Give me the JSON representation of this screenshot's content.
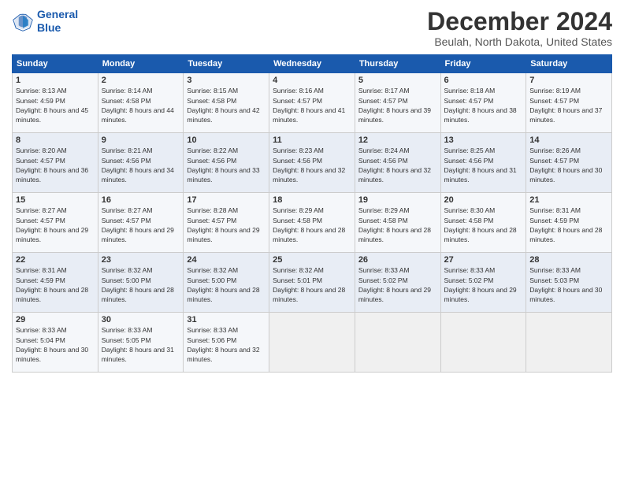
{
  "header": {
    "logo_line1": "General",
    "logo_line2": "Blue",
    "title": "December 2024",
    "location": "Beulah, North Dakota, United States"
  },
  "weekdays": [
    "Sunday",
    "Monday",
    "Tuesday",
    "Wednesday",
    "Thursday",
    "Friday",
    "Saturday"
  ],
  "weeks": [
    [
      {
        "day": "1",
        "sunrise": "8:13 AM",
        "sunset": "4:59 PM",
        "daylight": "8 hours and 45 minutes."
      },
      {
        "day": "2",
        "sunrise": "8:14 AM",
        "sunset": "4:58 PM",
        "daylight": "8 hours and 44 minutes."
      },
      {
        "day": "3",
        "sunrise": "8:15 AM",
        "sunset": "4:58 PM",
        "daylight": "8 hours and 42 minutes."
      },
      {
        "day": "4",
        "sunrise": "8:16 AM",
        "sunset": "4:57 PM",
        "daylight": "8 hours and 41 minutes."
      },
      {
        "day": "5",
        "sunrise": "8:17 AM",
        "sunset": "4:57 PM",
        "daylight": "8 hours and 39 minutes."
      },
      {
        "day": "6",
        "sunrise": "8:18 AM",
        "sunset": "4:57 PM",
        "daylight": "8 hours and 38 minutes."
      },
      {
        "day": "7",
        "sunrise": "8:19 AM",
        "sunset": "4:57 PM",
        "daylight": "8 hours and 37 minutes."
      }
    ],
    [
      {
        "day": "8",
        "sunrise": "8:20 AM",
        "sunset": "4:57 PM",
        "daylight": "8 hours and 36 minutes."
      },
      {
        "day": "9",
        "sunrise": "8:21 AM",
        "sunset": "4:56 PM",
        "daylight": "8 hours and 34 minutes."
      },
      {
        "day": "10",
        "sunrise": "8:22 AM",
        "sunset": "4:56 PM",
        "daylight": "8 hours and 33 minutes."
      },
      {
        "day": "11",
        "sunrise": "8:23 AM",
        "sunset": "4:56 PM",
        "daylight": "8 hours and 32 minutes."
      },
      {
        "day": "12",
        "sunrise": "8:24 AM",
        "sunset": "4:56 PM",
        "daylight": "8 hours and 32 minutes."
      },
      {
        "day": "13",
        "sunrise": "8:25 AM",
        "sunset": "4:56 PM",
        "daylight": "8 hours and 31 minutes."
      },
      {
        "day": "14",
        "sunrise": "8:26 AM",
        "sunset": "4:57 PM",
        "daylight": "8 hours and 30 minutes."
      }
    ],
    [
      {
        "day": "15",
        "sunrise": "8:27 AM",
        "sunset": "4:57 PM",
        "daylight": "8 hours and 29 minutes."
      },
      {
        "day": "16",
        "sunrise": "8:27 AM",
        "sunset": "4:57 PM",
        "daylight": "8 hours and 29 minutes."
      },
      {
        "day": "17",
        "sunrise": "8:28 AM",
        "sunset": "4:57 PM",
        "daylight": "8 hours and 29 minutes."
      },
      {
        "day": "18",
        "sunrise": "8:29 AM",
        "sunset": "4:58 PM",
        "daylight": "8 hours and 28 minutes."
      },
      {
        "day": "19",
        "sunrise": "8:29 AM",
        "sunset": "4:58 PM",
        "daylight": "8 hours and 28 minutes."
      },
      {
        "day": "20",
        "sunrise": "8:30 AM",
        "sunset": "4:58 PM",
        "daylight": "8 hours and 28 minutes."
      },
      {
        "day": "21",
        "sunrise": "8:31 AM",
        "sunset": "4:59 PM",
        "daylight": "8 hours and 28 minutes."
      }
    ],
    [
      {
        "day": "22",
        "sunrise": "8:31 AM",
        "sunset": "4:59 PM",
        "daylight": "8 hours and 28 minutes."
      },
      {
        "day": "23",
        "sunrise": "8:32 AM",
        "sunset": "5:00 PM",
        "daylight": "8 hours and 28 minutes."
      },
      {
        "day": "24",
        "sunrise": "8:32 AM",
        "sunset": "5:00 PM",
        "daylight": "8 hours and 28 minutes."
      },
      {
        "day": "25",
        "sunrise": "8:32 AM",
        "sunset": "5:01 PM",
        "daylight": "8 hours and 28 minutes."
      },
      {
        "day": "26",
        "sunrise": "8:33 AM",
        "sunset": "5:02 PM",
        "daylight": "8 hours and 29 minutes."
      },
      {
        "day": "27",
        "sunrise": "8:33 AM",
        "sunset": "5:02 PM",
        "daylight": "8 hours and 29 minutes."
      },
      {
        "day": "28",
        "sunrise": "8:33 AM",
        "sunset": "5:03 PM",
        "daylight": "8 hours and 30 minutes."
      }
    ],
    [
      {
        "day": "29",
        "sunrise": "8:33 AM",
        "sunset": "5:04 PM",
        "daylight": "8 hours and 30 minutes."
      },
      {
        "day": "30",
        "sunrise": "8:33 AM",
        "sunset": "5:05 PM",
        "daylight": "8 hours and 31 minutes."
      },
      {
        "day": "31",
        "sunrise": "8:33 AM",
        "sunset": "5:06 PM",
        "daylight": "8 hours and 32 minutes."
      },
      null,
      null,
      null,
      null
    ]
  ]
}
